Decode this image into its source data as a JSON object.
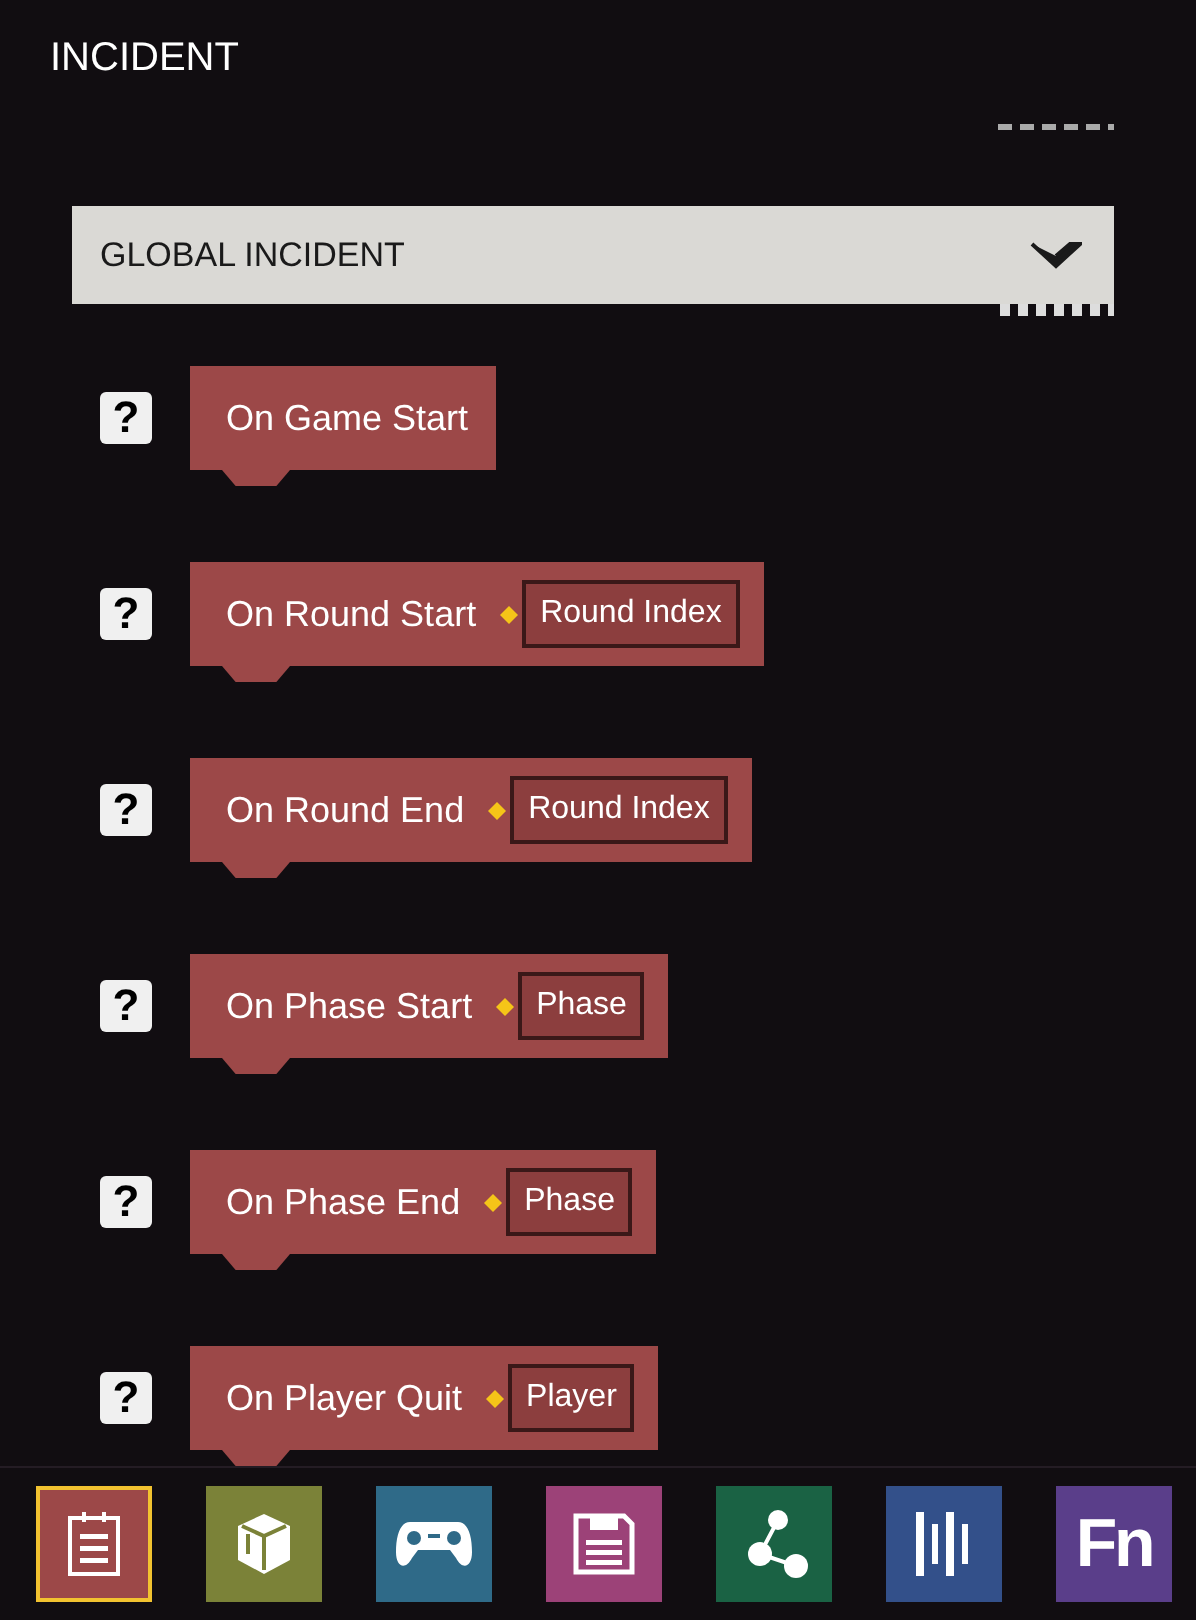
{
  "title": "INCIDENT",
  "dropdown": {
    "value": "GLOBAL INCIDENT"
  },
  "events": [
    {
      "help": "?",
      "label": "On Game Start"
    },
    {
      "help": "?",
      "label": "On Round Start",
      "param": "Round Index"
    },
    {
      "help": "?",
      "label": "On Round End",
      "param": "Round Index"
    },
    {
      "help": "?",
      "label": "On Phase Start",
      "param": "Phase"
    },
    {
      "help": "?",
      "label": "On Phase End",
      "param": "Phase"
    },
    {
      "help": "?",
      "label": "On Player Quit",
      "param": "Player"
    }
  ],
  "toolbar": [
    {
      "kind": "clipboard",
      "color": "#9c4848",
      "selected": true
    },
    {
      "kind": "box",
      "color": "#7b8238",
      "selected": false
    },
    {
      "kind": "gamepad",
      "color": "#2f6a88",
      "selected": false
    },
    {
      "kind": "save",
      "color": "#9c4278",
      "selected": false
    },
    {
      "kind": "share",
      "color": "#1a6244",
      "selected": false
    },
    {
      "kind": "bars",
      "color": "#33508a",
      "selected": false
    },
    {
      "kind": "text",
      "text": "Fn",
      "color": "#5a3e8a",
      "selected": false
    }
  ]
}
